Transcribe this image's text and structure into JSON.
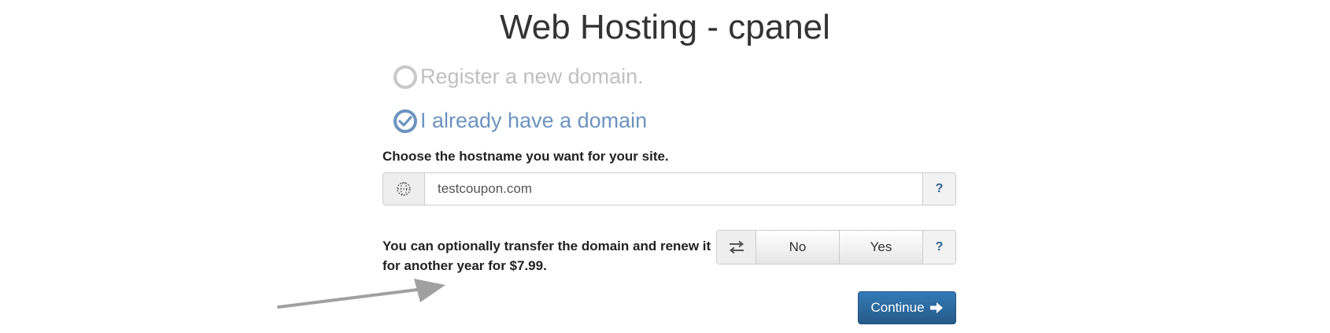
{
  "page": {
    "title": "Web Hosting - cpanel"
  },
  "domain_options": [
    {
      "label": "Register a new domain.",
      "selected": false
    },
    {
      "label": "I already have a domain",
      "selected": true
    }
  ],
  "hostname": {
    "label": "Choose the hostname you want for your site.",
    "value": "testcoupon.com",
    "help_label": "?",
    "icon": "globe-icon"
  },
  "transfer": {
    "text": "You can optionally transfer the domain and renew it for another year for $7.99.",
    "icon": "transfer-icon",
    "no_label": "No",
    "yes_label": "Yes",
    "help_label": "?"
  },
  "continue_button": {
    "label": "Continue",
    "icon": "arrow-right-icon"
  },
  "colors": {
    "selected_option": "#6c94bf",
    "unselected_option": "#c0c0c0",
    "primary_button": "#337ab7",
    "help_text": "#2e6090",
    "annotation_arrow": "#a0a0a0"
  }
}
